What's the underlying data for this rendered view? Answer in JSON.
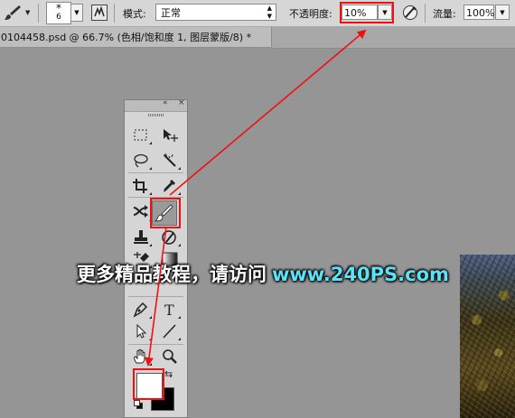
{
  "options_bar": {
    "brush_size": "6",
    "mode_label": "模式:",
    "mode_value": "正常",
    "opacity_label": "不透明度:",
    "opacity_value": "10%",
    "flow_label": "流量:",
    "flow_value": "100%"
  },
  "document_tab": {
    "title": "0104458.psd @ 66.7% (色相/饱和度 1, 图层蒙版/8) *",
    "close": "×"
  },
  "tool_panel": {
    "tools": [
      {
        "name": "rectangular-marquee-tool",
        "icon": "marquee-icon"
      },
      {
        "name": "move-tool",
        "icon": "move-icon"
      },
      {
        "name": "lasso-tool",
        "icon": "lasso-icon"
      },
      {
        "name": "magic-wand-tool",
        "icon": "magic-wand-icon"
      },
      {
        "name": "crop-tool",
        "icon": "crop-icon"
      },
      {
        "name": "eyedropper-tool",
        "icon": "eyedropper-icon"
      },
      {
        "name": "healing-brush-tool",
        "icon": "healing-icon"
      },
      {
        "name": "brush-tool",
        "icon": "brush-icon",
        "active": true
      },
      {
        "name": "clone-stamp-tool",
        "icon": "stamp-icon"
      },
      {
        "name": "history-brush-tool",
        "icon": "history-brush-icon"
      },
      {
        "name": "eraser-tool",
        "icon": "eraser-icon"
      },
      {
        "name": "gradient-tool",
        "icon": "gradient-icon"
      },
      {
        "name": "pen-tool",
        "icon": "pen-icon"
      },
      {
        "name": "type-tool",
        "icon": "type-icon",
        "label": "T"
      },
      {
        "name": "path-selection-tool",
        "icon": "path-select-icon"
      },
      {
        "name": "line-tool",
        "icon": "line-icon"
      },
      {
        "name": "hand-tool",
        "icon": "hand-icon"
      },
      {
        "name": "zoom-tool",
        "icon": "zoom-icon"
      }
    ],
    "foreground_color": "#ffffff",
    "background_color": "#000000"
  },
  "watermark": {
    "chinese_text": "更多精品教程，请访问",
    "url_text": "www.240PS.com"
  },
  "colors": {
    "highlight": "#ee1111",
    "arrow": "#ee1111",
    "url": "#5be3f5"
  }
}
